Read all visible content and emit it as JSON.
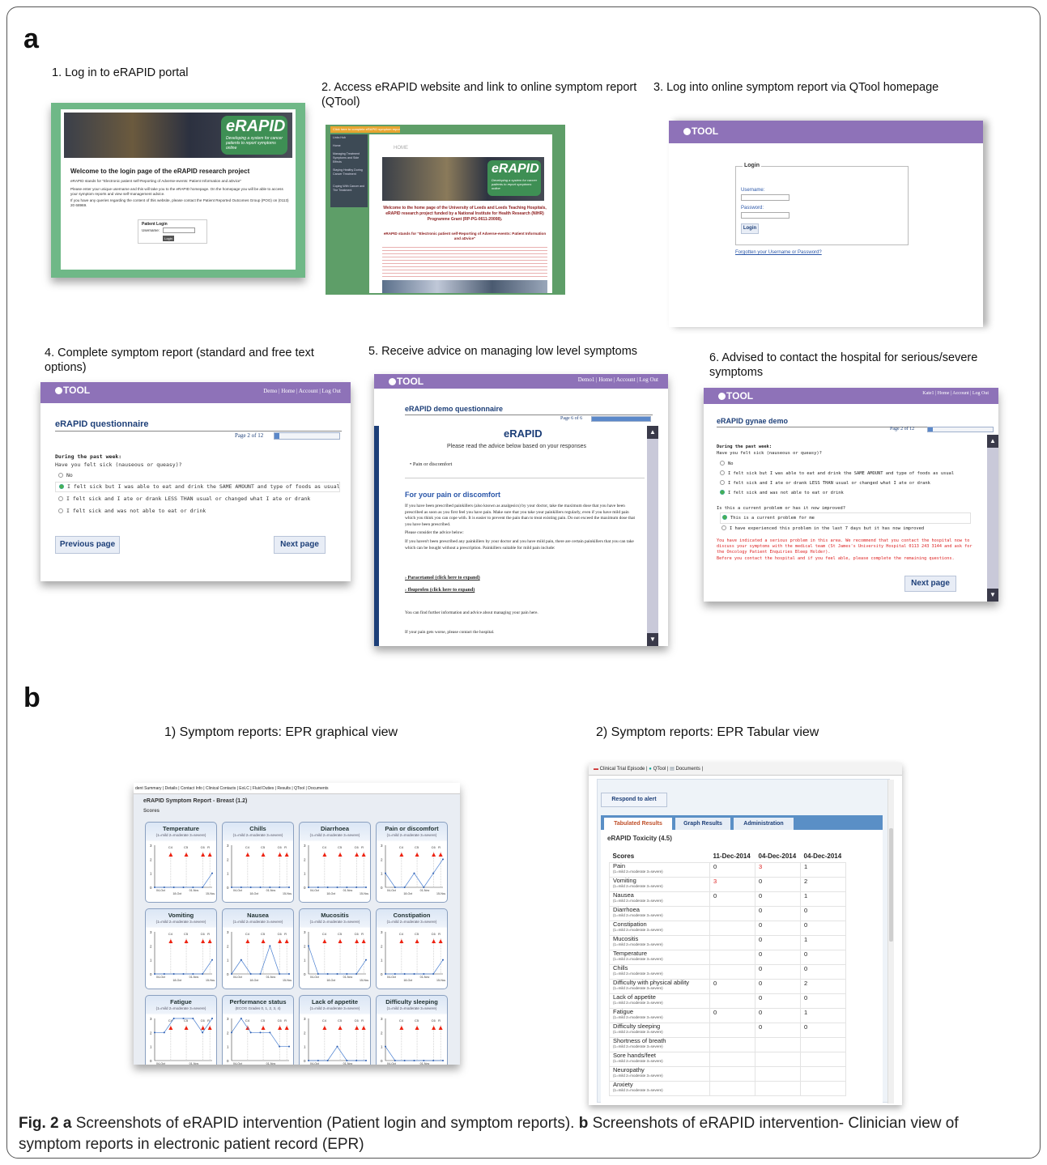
{
  "panel_a": {
    "letter": "a",
    "steps": [
      "1. Log in to eRAPID portal",
      "2. Access eRAPID website and link to online symptom report (QTool)",
      "3. Log into online symptom report via QTool homepage",
      "4. Complete symptom report (standard and free text options)",
      "5. Receive advice on managing low level symptoms",
      "6. Advised to contact the hospital for serious/severe symptoms"
    ],
    "shot1": {
      "logo": "eRAPID",
      "tagline": "Developing a system for cancer patients to report symptoms online",
      "heading": "Welcome to the login page of the eRAPID research project",
      "para1": "eRAPID stands for \"Electronic patient self-Reporting of Adverse-events: Patient Information and aDvice\"",
      "para2": "Please enter your unique username and this will take you to the eRAPID homepage. On the homepage you will be able to access your symptom reports and view self-management advice.",
      "para3": "If you have any queries regarding the content of this website, please contact the Patient Reported Outcomes Group (POG) on (0113) 20 68969.",
      "login_title": "Patient Login",
      "username_label": "Username:",
      "login_button": "Login"
    },
    "shot2": {
      "banner": "Click here to complete eRAPID symptom report",
      "nav": [
        "Links Hub",
        "Home",
        "Managing Treatment Symptoms and Side Effects",
        "Staying Healthy During Cancer Treatment",
        "Coping With Cancer and The Treatment"
      ],
      "home_label": "HOME",
      "logo": "eRAPID",
      "tagline": "Developing a system for cancer patients to report symptoms online",
      "heading": "Welcome to the home page of the University of Leeds and Leeds Teaching Hospitals, eRAPID research project funded by a National Institute for Health Research (NIHR) Programme Grant (RP-PG-0611-20008).",
      "subheading": "eRAPID stands for \"Electronic patient self-Reporting of Adverse-events: Patient Information and aDvice\""
    },
    "shot3": {
      "logo": "TOOL",
      "login_legend": "Login",
      "username_label": "Username:",
      "password_label": "Password:",
      "login_button": "Login",
      "forgot_link": "Forgotten your Username or Password?"
    },
    "shot4": {
      "logo": "TOOL",
      "links": "Demo | Home | Account | Log Out",
      "title": "eRAPID questionnaire",
      "page": "Page 2 of 12",
      "progress": 0.08,
      "section": "During the past week:",
      "question": "Have you felt sick (nauseous or queasy)?",
      "options": [
        "No",
        "I felt sick but I was able to eat and drink the SAME AMOUNT and type of foods as usual",
        "I felt sick and I ate or drank LESS THAN usual or changed what I ate or drank",
        "I felt sick and was not able to eat or drink"
      ],
      "selected_index": 1,
      "prev_button": "Previous page",
      "next_button": "Next page"
    },
    "shot5": {
      "logo": "TOOL",
      "links": "Demo1 | Home | Account | Log Out",
      "title": "eRAPID demo questionnaire",
      "page": "Page 6 of 6",
      "progress": 1.0,
      "brand": "eRAPID",
      "intro": "Please read the advice below based on your responses",
      "bullet": "• Pain or discomfort",
      "heading": "For your pain or discomfort",
      "p1": "If you have been prescribed painkillers (also known as analgesics) by your doctor, take the maximum dose that you have been prescribed as soon as you first feel you have pain. Make sure that you take your painkillers regularly, even if you have mild pain which you think you can cope with. It is easier to prevent the pain than to treat existing pain. Do not exceed the maximum dose that you have been prescribed.",
      "p2": "Please consider the advice below:",
      "p3": "If you haven't been prescribed any painkillers by your doctor and you have mild pain, there are certain painkillers that you can take which can be bought without a prescription. Painkillers suitable for mild pain include:",
      "link1": "Paracetamol",
      "link2": "Ibuprofen",
      "expand": "(click here to expand)",
      "p4": "You can find further information and advice about managing your pain here.",
      "p5": "If your pain gets worse, please contact the hospital."
    },
    "shot6": {
      "logo": "TOOL",
      "links": "Kate1 | Home | Account | Log Out",
      "title": "eRAPID gynae demo",
      "page": "Page 2 of 12",
      "progress": 0.08,
      "section": "During the past week:",
      "question": "Have you felt sick (nauseous or queasy)?",
      "options": [
        "No",
        "I felt sick but I was able to eat and drink the SAME AMOUNT and type of foods as usual",
        "I felt sick and I ate or drank LESS THAN usual or changed what I ate or drank",
        "I felt sick and was not able to eat or drink"
      ],
      "selected_index": 3,
      "q2": "Is this a current problem or has it now improved?",
      "q2_options": [
        "This is a current problem for me",
        "I have experienced this problem in the last 7 days but it has now improved"
      ],
      "q2_selected": 0,
      "warning": "You have indicated a serious problem in this area. We recommend that you contact the hospital now to discuss your symptoms with the medical team (St James's University Hospital 0113 243 3144 and ask for the Oncology Patient Enquiries Bleep Holder).",
      "warning2": "Before you contact the hospital and if you feel able, please complete the remaining questions.",
      "next_button": "Next page"
    }
  },
  "panel_b": {
    "letter": "b",
    "views": [
      "1)  Symptom reports: EPR graphical view",
      "2) Symptom reports: EPR Tabular view"
    ],
    "graph": {
      "tabs": "dent Summary | Details | Contact Info | Clinical Contacts | EoLC | Fluid Duties | Results | QTool | Documents",
      "title": "eRAPID Symptom Report - Breast (1.2)",
      "subtitle": "Scores",
      "grade_scale": "(1=mild 2=moderate 3=severe)",
      "tiles": [
        {
          "name": "Temperature",
          "scale": "(1=mild 2=moderate 3=severe)",
          "values": [
            0,
            0,
            0,
            0,
            0,
            0,
            1
          ]
        },
        {
          "name": "Chills",
          "scale": "(1=mild 2=moderate 3=severe)",
          "values": [
            0,
            0,
            0,
            0,
            0,
            0,
            0
          ]
        },
        {
          "name": "Diarrhoea",
          "scale": "(1=mild 2=moderate 3=severe)",
          "values": [
            0,
            0,
            0,
            0,
            0,
            0,
            0
          ]
        },
        {
          "name": "Pain or discomfort",
          "scale": "(1=mild 2=moderate 3=severe)",
          "values": [
            1,
            0,
            0,
            1,
            0,
            1,
            2
          ]
        },
        {
          "name": "Vomiting",
          "scale": "(1=mild 2=moderate 3=severe)",
          "values": [
            0,
            0,
            0,
            0,
            0,
            0,
            1
          ]
        },
        {
          "name": "Nausea",
          "scale": "(1=mild 2=moderate 3=severe)",
          "values": [
            0,
            1,
            0,
            0,
            2,
            0,
            0
          ]
        },
        {
          "name": "Mucositis",
          "scale": "(1=mild 2=moderate 3=severe)",
          "values": [
            2,
            0,
            0,
            0,
            0,
            0,
            1
          ]
        },
        {
          "name": "Constipation",
          "scale": "(1=mild 2=moderate 3=severe)",
          "values": [
            0,
            0,
            0,
            0,
            0,
            0,
            1
          ]
        },
        {
          "name": "Fatigue",
          "scale": "(1=mild 2=moderate 3=severe)",
          "values": [
            2,
            2,
            3,
            3,
            3,
            2,
            3
          ]
        },
        {
          "name": "Performance status",
          "scale": "(ECOG Grades 0, 1, 2, 3, 4)",
          "values": [
            2,
            3,
            2,
            2,
            2,
            1,
            1
          ]
        },
        {
          "name": "Lack of appetite",
          "scale": "(1=mild 2=moderate 3=severe)",
          "values": [
            0,
            0,
            0,
            1,
            0,
            0,
            0
          ]
        },
        {
          "name": "Difficulty sleeping",
          "scale": "(1=mild 2=moderate 3=severe)",
          "values": [
            1,
            0,
            0,
            0,
            0,
            0,
            0
          ]
        }
      ],
      "cycle_labels": [
        "C4",
        "C5",
        "C6",
        "R"
      ],
      "x_ticks": [
        "04-Oct",
        "18-Oct",
        "01-Nov",
        "15-Nov"
      ]
    },
    "table": {
      "tabs": [
        "Clinical Trial Episode",
        "QTool",
        "Documents"
      ],
      "alert_button": "Respond to alert",
      "subtabs": [
        "Tabulated Results",
        "Graph Results",
        "Administration"
      ],
      "title": "eRAPID Toxicity (4.5)",
      "columns": [
        "Scores",
        "11-Dec-2014",
        "04-Dec-2014",
        "04-Dec-2014"
      ],
      "scale": "(1=mild 2=moderate 3=severe)",
      "rows": [
        {
          "name": "Pain",
          "v": [
            "0",
            "3",
            "1"
          ]
        },
        {
          "name": "Vomiting",
          "v": [
            "3",
            "0",
            "2"
          ]
        },
        {
          "name": "Nausea",
          "v": [
            "0",
            "0",
            "1"
          ]
        },
        {
          "name": "Diarrhoea",
          "v": [
            "",
            "0",
            "0"
          ]
        },
        {
          "name": "Constipation",
          "v": [
            "",
            "0",
            "0"
          ]
        },
        {
          "name": "Mucositis",
          "v": [
            "",
            "0",
            "1"
          ]
        },
        {
          "name": "Temperature",
          "v": [
            "",
            "0",
            "0"
          ]
        },
        {
          "name": "Chills",
          "v": [
            "",
            "0",
            "0"
          ]
        },
        {
          "name": "Difficulty with physical ability",
          "v": [
            "0",
            "0",
            "2"
          ]
        },
        {
          "name": "Lack of appetite",
          "v": [
            "",
            "0",
            "0"
          ]
        },
        {
          "name": "Fatigue",
          "v": [
            "0",
            "0",
            "1"
          ]
        },
        {
          "name": "Difficulty sleeping",
          "v": [
            "",
            "0",
            "0"
          ]
        },
        {
          "name": "Shortness of breath",
          "v": [
            "",
            "",
            ""
          ]
        },
        {
          "name": "Sore hands/feet",
          "v": [
            "",
            "",
            ""
          ]
        },
        {
          "name": "Neuropathy",
          "v": [
            "",
            "",
            ""
          ]
        },
        {
          "name": "Anxiety",
          "v": [
            "",
            "",
            ""
          ]
        }
      ]
    }
  },
  "caption": {
    "fig": "Fig. 2",
    "a_letter": "a",
    "a_text": " Screenshots of eRAPID intervention (Patient login and symptom reports). ",
    "b_letter": "b",
    "b_text": " Screenshots of eRAPID intervention- Clinician view of symptom reports in electronic patient record (EPR)"
  }
}
